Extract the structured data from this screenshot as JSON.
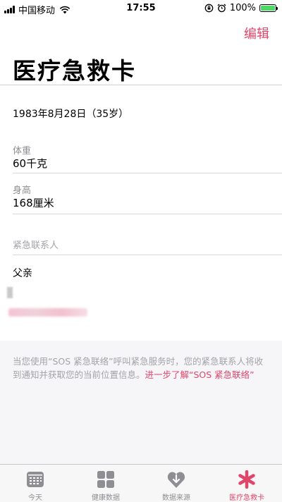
{
  "status_bar": {
    "carrier": "中国移动",
    "time": "17:55",
    "battery": "100%",
    "battery_level": 1.0
  },
  "nav": {
    "edit_label": "编辑",
    "title": "医疗急救卡"
  },
  "profile": {
    "dob": "1983年8月28日（35岁）",
    "weight_label": "体重",
    "weight_value": "60千克",
    "height_label": "身高",
    "height_value": "168厘米"
  },
  "emergency": {
    "section_label": "紧急联系人",
    "contact_relation": "父亲"
  },
  "footer": {
    "text": "当您使用“SOS 紧急联络”呼叫紧急服务时，您的紧急联系人将收到通知并获取您的当前位置信息。",
    "link": "进一步了解“SOS 紧急联络”"
  },
  "tabs": [
    {
      "label": "今天",
      "icon": "calendar-icon"
    },
    {
      "label": "健康数据",
      "icon": "grid-icon"
    },
    {
      "label": "数据来源",
      "icon": "heart-download-icon"
    },
    {
      "label": "医疗急救卡",
      "icon": "asterisk-icon"
    }
  ],
  "colors": {
    "accent": "#e0456b",
    "secondary_text": "#8e8e93",
    "battery": "#4cd964"
  }
}
